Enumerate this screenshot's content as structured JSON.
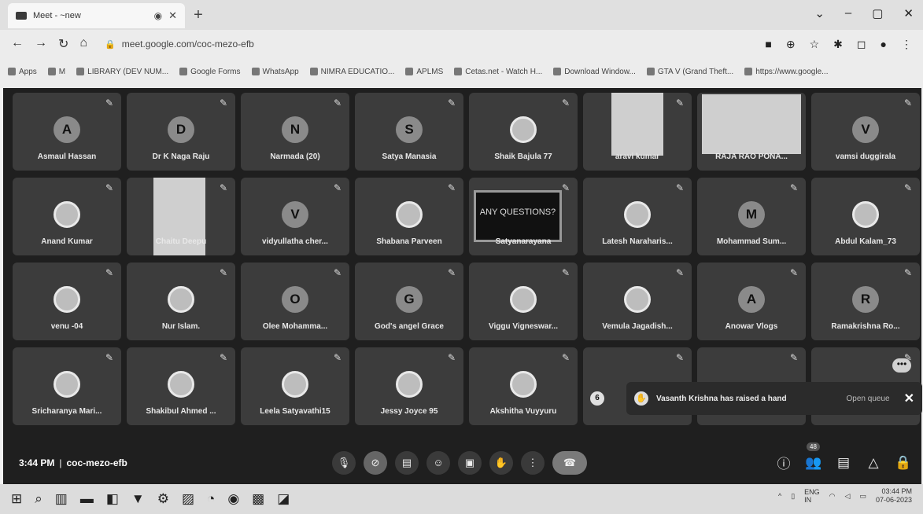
{
  "browser": {
    "tab_title": "Meet - ~new",
    "sound_icon": "speaker-icon",
    "url": "meet.google.com/coc-mezo-efb",
    "bookmarks": [
      "Apps",
      "M",
      "LIBRARY (DEV NUM...",
      "Google Forms",
      "WhatsApp",
      "NIMRA EDUCATIO...",
      "APLMS",
      "Cetas.net - Watch H...",
      "Download Window...",
      "GTA V (Grand Theft...",
      "https://www.google..."
    ]
  },
  "tiles": [
    {
      "name": "Asmaul Hassan",
      "initial": "A"
    },
    {
      "name": "Dr K Naga Raju",
      "initial": "D"
    },
    {
      "name": "Narmada (20)",
      "initial": "N"
    },
    {
      "name": "Satya Manasia",
      "initial": "S"
    },
    {
      "name": "Shaik Bajula 77",
      "initial": ""
    },
    {
      "name": "aravi kumar",
      "initial": ""
    },
    {
      "name": "RAJA RAO PONA...",
      "initial": ""
    },
    {
      "name": "vamsi duggirala",
      "initial": "V"
    },
    {
      "name": "Anand Kumar",
      "initial": ""
    },
    {
      "name": "Chaitu Deepu",
      "initial": ""
    },
    {
      "name": "vidyullatha cher...",
      "initial": "V"
    },
    {
      "name": "Shabana Parveen",
      "initial": ""
    },
    {
      "name": "Satyanarayana",
      "initial": ""
    },
    {
      "name": "Latesh Naraharis...",
      "initial": ""
    },
    {
      "name": "Mohammad Sum...",
      "initial": "M"
    },
    {
      "name": "Abdul Kalam_73",
      "initial": ""
    },
    {
      "name": "venu -04",
      "initial": ""
    },
    {
      "name": "Nur Islam.",
      "initial": ""
    },
    {
      "name": "Olee Mohamma...",
      "initial": "O"
    },
    {
      "name": "God's angel Grace",
      "initial": "G"
    },
    {
      "name": "Viggu Vigneswar...",
      "initial": ""
    },
    {
      "name": "Vemula Jagadish...",
      "initial": ""
    },
    {
      "name": "Anowar Vlogs",
      "initial": "A"
    },
    {
      "name": "Ramakrishna Ro...",
      "initial": "R"
    },
    {
      "name": "Sricharanya Mari...",
      "initial": ""
    },
    {
      "name": "Shakibul Ahmed ...",
      "initial": ""
    },
    {
      "name": "Leela Satyavathi15",
      "initial": ""
    },
    {
      "name": "Jessy Joyce 95",
      "initial": ""
    },
    {
      "name": "Akshitha Vuyyuru",
      "initial": ""
    },
    {
      "name": "",
      "initial": ""
    },
    {
      "name": "",
      "initial": ""
    },
    {
      "name": "",
      "initial": ""
    }
  ],
  "presentation_text": "ANY QUESTIONS?",
  "notification": {
    "message": "Vasanth Krishna has raised a hand",
    "open_queue": "Open queue",
    "small_badge": "6"
  },
  "meeting": {
    "time": "3:44 PM",
    "separator": "|",
    "code": "coc-mezo-efb",
    "participant_count": "48"
  },
  "taskbar": {
    "lang": "ENG",
    "region": "IN",
    "clock_time": "03:44 PM",
    "clock_date": "07-06-2023"
  }
}
